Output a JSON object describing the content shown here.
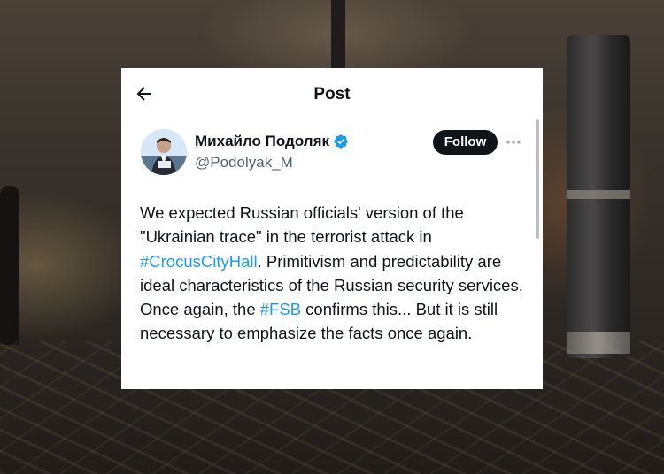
{
  "header": {
    "title": "Post",
    "back_icon": "arrow-left-icon"
  },
  "author": {
    "name": "Михайло Подоляк",
    "handle": "@Podolyak_M",
    "verified": true,
    "verified_color": "#1d9bf0"
  },
  "actions": {
    "follow_label": "Follow",
    "more_icon": "more-horizontal-icon"
  },
  "tweet": {
    "text_1": "We expected Russian officials' version of the \"Ukrainian trace\" in the terrorist attack in ",
    "hashtag_1": "#CrocusCityHall",
    "text_2": ". Primitivism and predictability are ideal characteristics of the Russian security services. Once again, the ",
    "hashtag_2": "#FSB",
    "text_3": " confirms this... But it is still necessary to emphasize the facts once again."
  },
  "colors": {
    "accent": "#1d9bf0",
    "text": "#0f1419",
    "muted": "#536471",
    "button": "#0f1419"
  }
}
